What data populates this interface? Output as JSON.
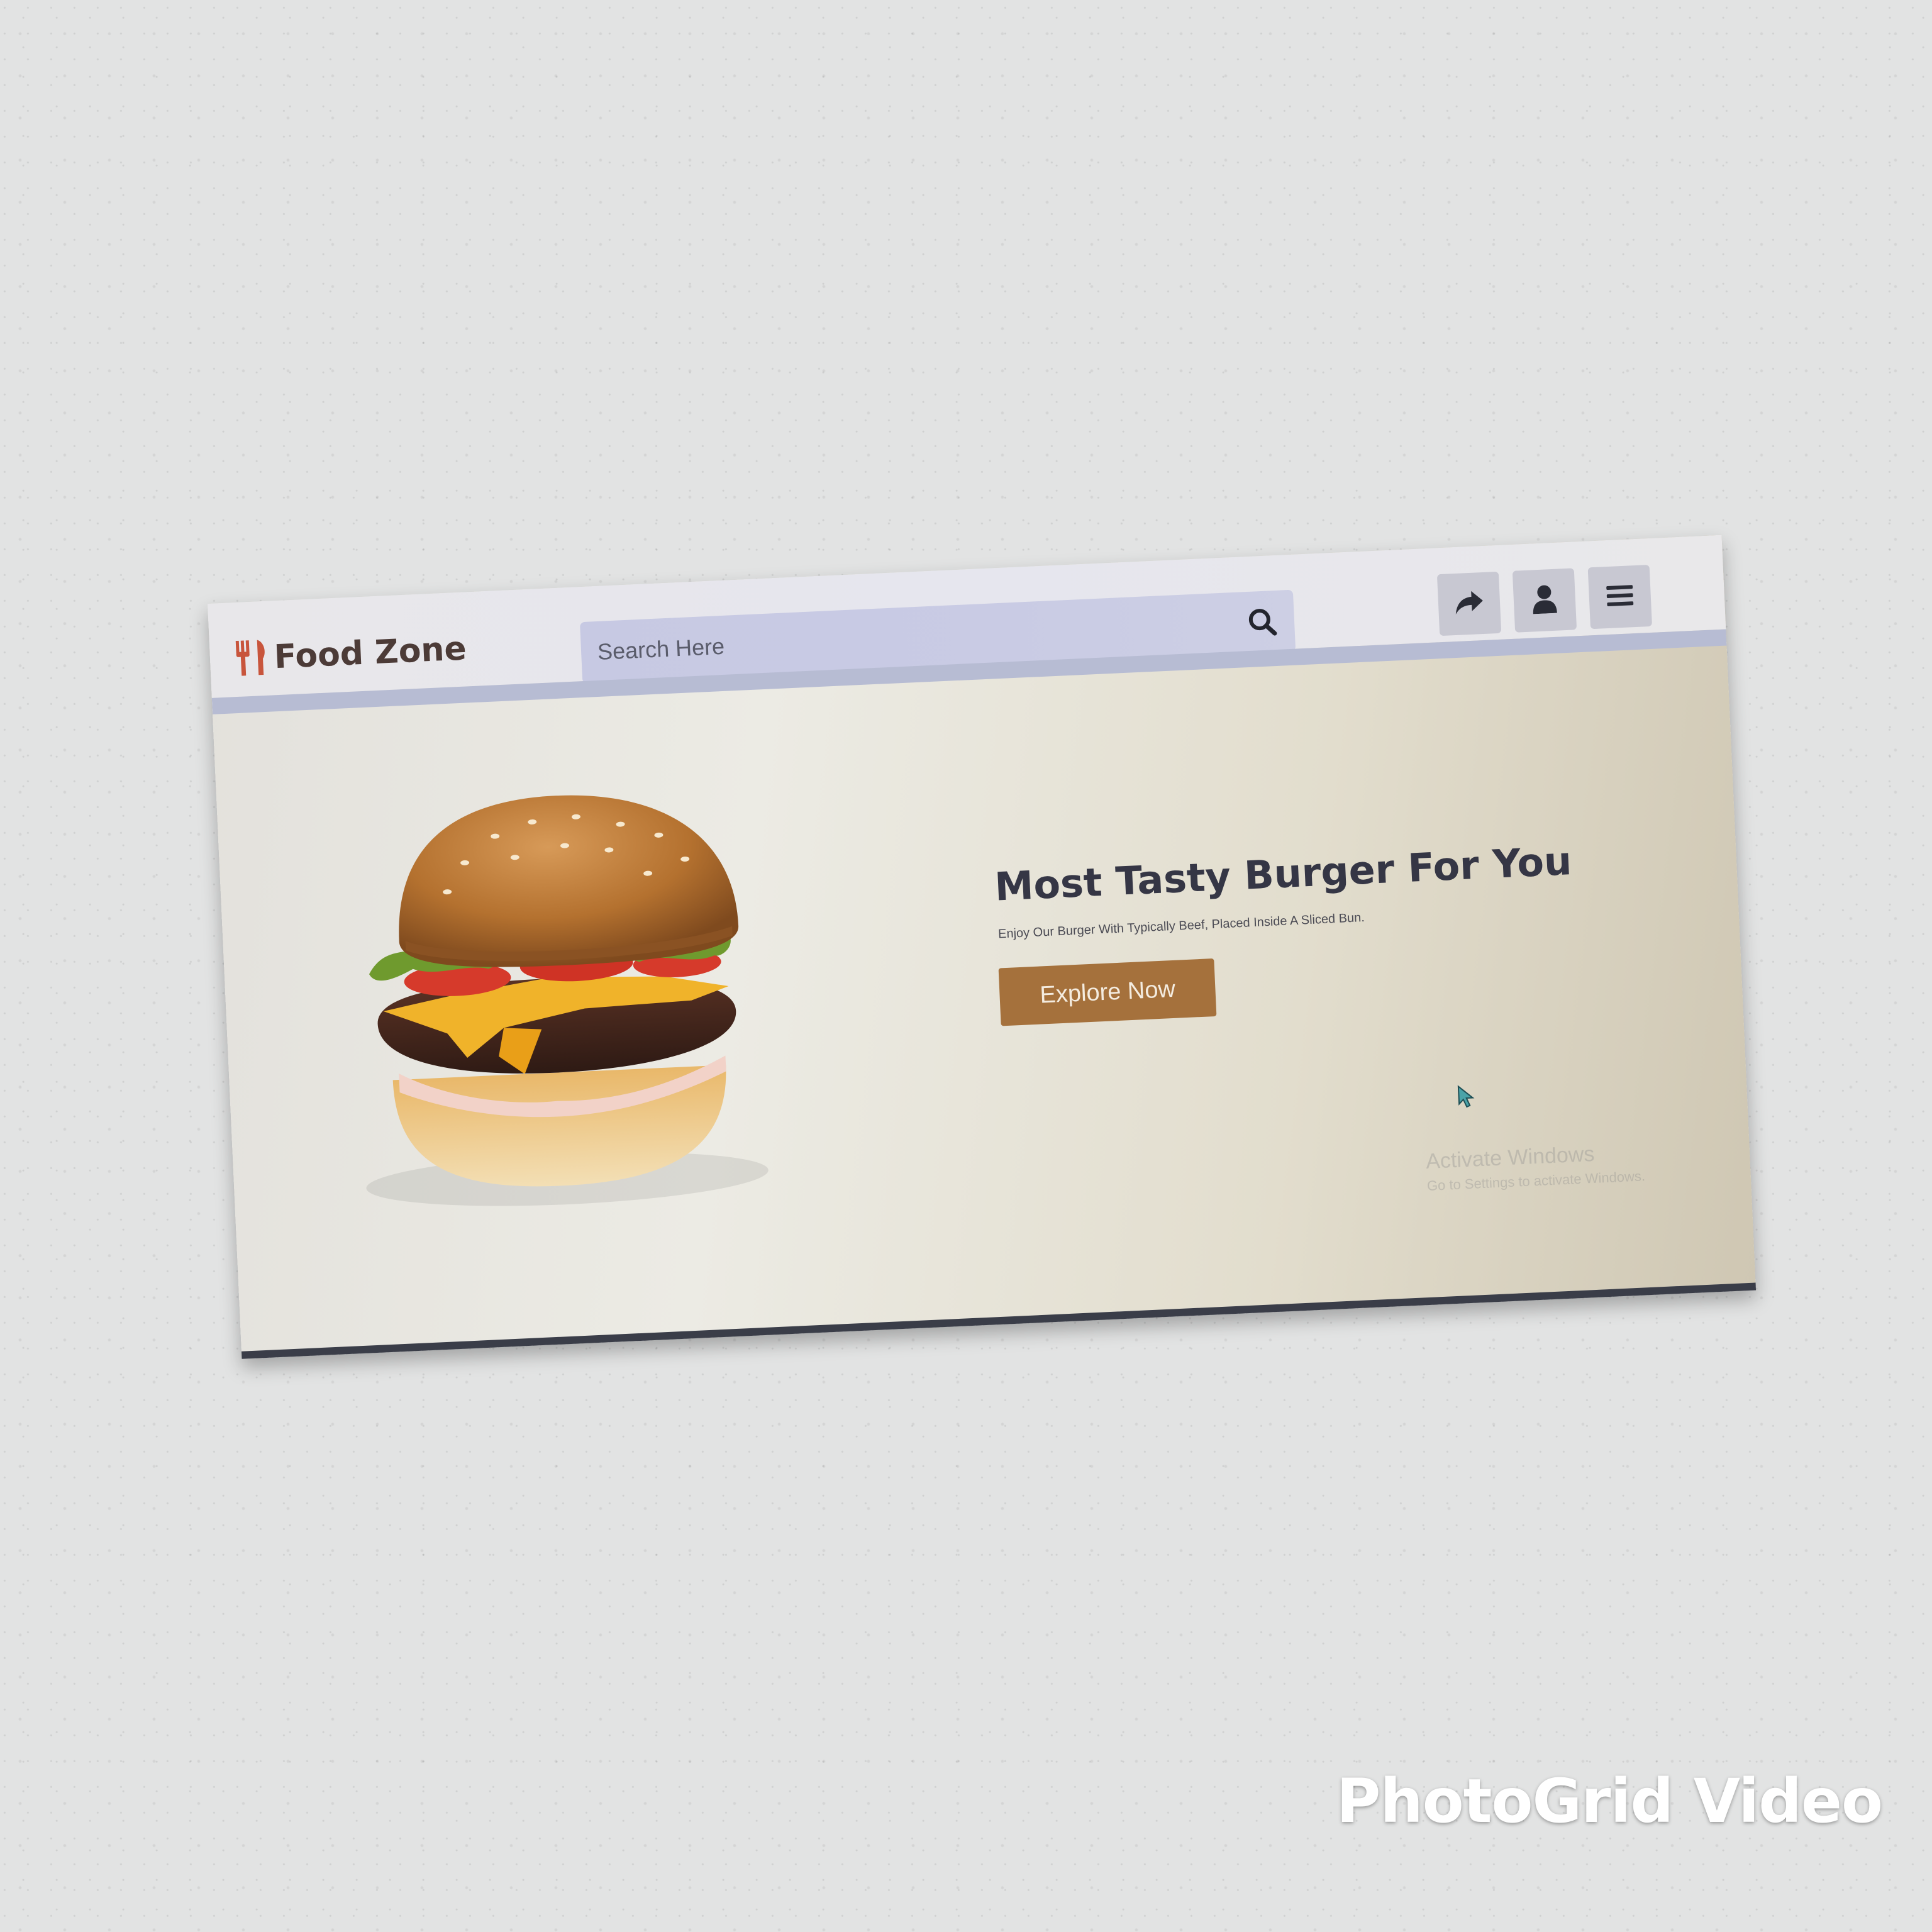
{
  "brand": {
    "name": "Food Zone",
    "icon": "fork-knife-icon",
    "color": "#c8553c"
  },
  "search": {
    "placeholder": "Search Here",
    "icon": "search-icon"
  },
  "nav_actions": [
    {
      "icon": "share-icon"
    },
    {
      "icon": "user-icon"
    },
    {
      "icon": "menu-icon"
    }
  ],
  "hero": {
    "title": "Most Tasty Burger For You",
    "subtitle": "Enjoy Our Burger With Typically Beef, Placed Inside A Sliced Bun.",
    "cta_label": "Explore Now",
    "cta_color": "#a5713c",
    "image": "burger-image"
  },
  "os_overlay": {
    "line1": "Activate Windows",
    "line2": "Go to Settings to activate Windows."
  },
  "watermark": "PhotoGrid Video"
}
